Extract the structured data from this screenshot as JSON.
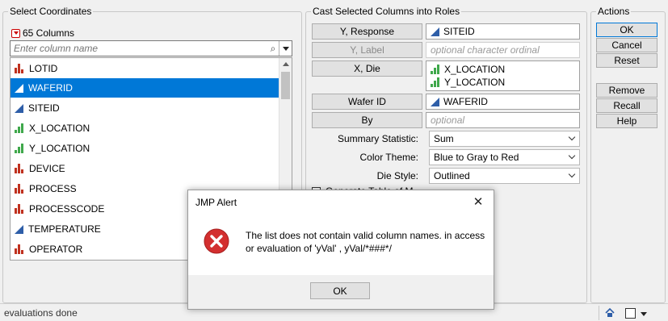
{
  "select_coordinates": {
    "title": "Select Coordinates",
    "column_count": "65 Columns",
    "search_placeholder": "Enter column name",
    "columns": [
      {
        "name": "LOTID",
        "type": "nominal"
      },
      {
        "name": "WAFERID",
        "type": "continuous",
        "selected": true
      },
      {
        "name": "SITEID",
        "type": "continuous"
      },
      {
        "name": "X_LOCATION",
        "type": "ordinal"
      },
      {
        "name": "Y_LOCATION",
        "type": "ordinal"
      },
      {
        "name": "DEVICE",
        "type": "nominal"
      },
      {
        "name": "PROCESS",
        "type": "nominal"
      },
      {
        "name": "PROCESSCODE",
        "type": "nominal"
      },
      {
        "name": "TEMPERATURE",
        "type": "continuous"
      },
      {
        "name": "OPERATOR",
        "type": "nominal"
      }
    ]
  },
  "cast_roles": {
    "title": "Cast Selected Columns into Roles",
    "roles": {
      "y_response": {
        "label": "Y, Response",
        "values": [
          "SITEID"
        ]
      },
      "y_label": {
        "label": "Y, Label",
        "placeholder": "optional character ordinal"
      },
      "x_die": {
        "label": "X, Die",
        "values": [
          "X_LOCATION",
          "Y_LOCATION"
        ]
      },
      "wafer_id": {
        "label": "Wafer ID",
        "values": [
          "WAFERID"
        ]
      },
      "by": {
        "label": "By",
        "placeholder": "optional"
      }
    },
    "options": {
      "summary_statistic": {
        "label": "Summary Statistic:",
        "value": "Sum"
      },
      "color_theme": {
        "label": "Color Theme:",
        "value": "Blue to Gray to Red"
      },
      "die_style": {
        "label": "Die Style:",
        "value": "Outlined"
      }
    },
    "checkbox_label": "Generate Table of M"
  },
  "actions": {
    "title": "Actions",
    "ok": "OK",
    "cancel": "Cancel",
    "reset": "Reset",
    "remove": "Remove",
    "recall": "Recall",
    "help": "Help"
  },
  "status_bar": {
    "text": "evaluations done"
  },
  "alert": {
    "title": "JMP Alert",
    "close_glyph": "✕",
    "message": "The list does not contain valid column names. in access or evaluation of 'yVal' , yVal/*###*/",
    "ok": "OK"
  },
  "colors": {
    "selection": "#0078d7",
    "nominal": "#c0311f",
    "ordinal": "#3fa84b",
    "continuous": "#2e5ea8",
    "error": "#d32f2f"
  }
}
